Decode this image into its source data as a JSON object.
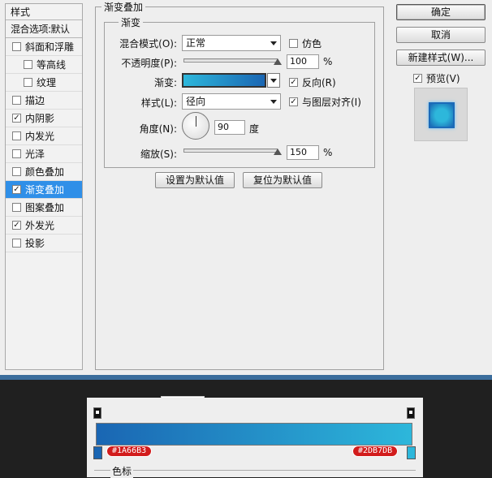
{
  "styles_panel": {
    "header": "样式",
    "blend_options": "混合选项:默认",
    "items": [
      {
        "label": "斜面和浮雕",
        "checked": false,
        "indent": false,
        "active": false
      },
      {
        "label": "等高线",
        "checked": false,
        "indent": true,
        "active": false
      },
      {
        "label": "纹理",
        "checked": false,
        "indent": true,
        "active": false
      },
      {
        "label": "描边",
        "checked": false,
        "indent": false,
        "active": false
      },
      {
        "label": "内阴影",
        "checked": true,
        "indent": false,
        "active": false
      },
      {
        "label": "内发光",
        "checked": false,
        "indent": false,
        "active": false
      },
      {
        "label": "光泽",
        "checked": false,
        "indent": false,
        "active": false
      },
      {
        "label": "颜色叠加",
        "checked": false,
        "indent": false,
        "active": false
      },
      {
        "label": "渐变叠加",
        "checked": true,
        "indent": false,
        "active": true
      },
      {
        "label": "图案叠加",
        "checked": false,
        "indent": false,
        "active": false
      },
      {
        "label": "外发光",
        "checked": true,
        "indent": false,
        "active": false
      },
      {
        "label": "投影",
        "checked": false,
        "indent": false,
        "active": false
      }
    ]
  },
  "gradient_overlay": {
    "title": "渐变叠加",
    "section": "渐变",
    "blend_mode_label": "混合模式(O):",
    "blend_mode_value": "正常",
    "dither_label": "仿色",
    "dither_checked": false,
    "opacity_label": "不透明度(P):",
    "opacity_value": "100",
    "opacity_unit": "%",
    "opacity_level": 1.0,
    "gradient_label": "渐变:",
    "reverse_label": "反向(R)",
    "reverse_checked": true,
    "style_label": "样式(L):",
    "style_value": "径向",
    "align_label": "与图层对齐(I)",
    "align_checked": true,
    "angle_label": "角度(N):",
    "angle_value": "90",
    "angle_unit": "度",
    "scale_label": "缩放(S):",
    "scale_value": "150",
    "scale_unit": "%",
    "scale_level": 1.0,
    "make_default": "设置为默认值",
    "reset_default": "复位为默认值"
  },
  "buttons": {
    "ok": "确定",
    "cancel": "取消",
    "new_style": "新建样式(W)...",
    "preview_label": "预览(V)",
    "preview_checked": true
  },
  "gradient_editor": {
    "stop_left_hex": "#1A66B3",
    "stop_right_hex": "#2DB7DB",
    "footer_label": "色标"
  },
  "colors": {
    "gradient_start": "#1A66B3",
    "gradient_end": "#2DB7DB",
    "selection": "#2f8fe8",
    "badge": "#d21c1c"
  }
}
